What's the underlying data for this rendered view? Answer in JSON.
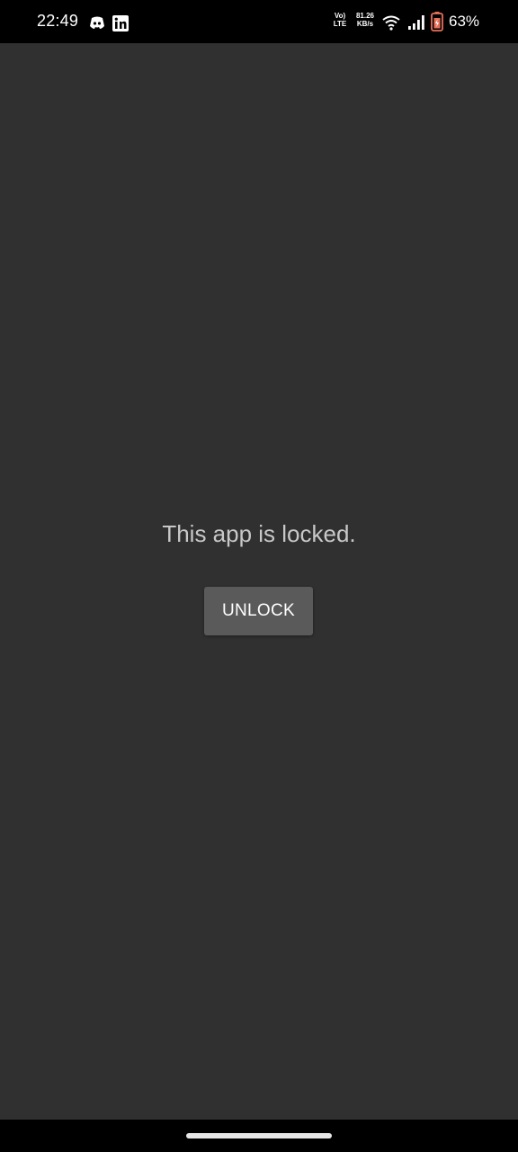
{
  "status_bar": {
    "time": "22:49",
    "volte_label_top": "Vo)",
    "volte_label_bottom": "LTE",
    "speed_value": "81.26",
    "speed_unit": "KB/s",
    "battery_percent": "63%",
    "icons": [
      "discord-icon",
      "linkedin-icon",
      "wifi-icon",
      "signal-icon",
      "battery-icon"
    ],
    "battery_color": "#e8705a"
  },
  "app": {
    "locked_message": "This app is locked.",
    "unlock_label": "UNLOCK",
    "background_color": "#303030",
    "button_color": "#5a5a5a"
  }
}
